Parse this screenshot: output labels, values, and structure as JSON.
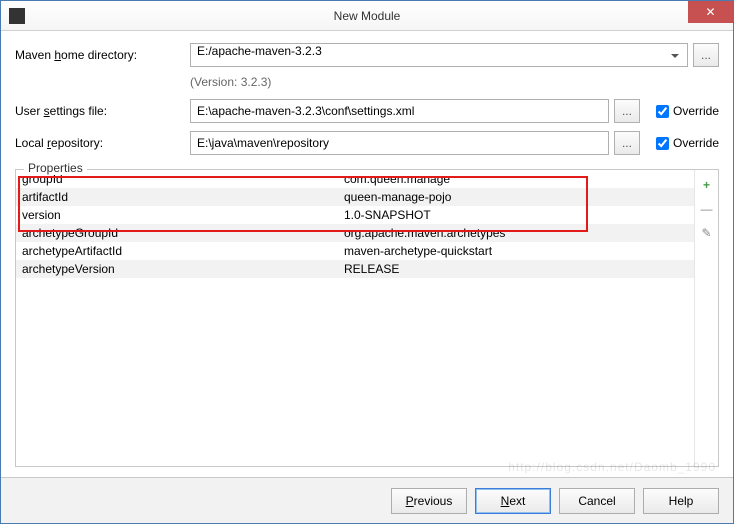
{
  "window": {
    "title": "New Module",
    "icon_letter": "IJ"
  },
  "form": {
    "maven_home_label_pre": "Maven ",
    "maven_home_label_u": "h",
    "maven_home_label_post": "ome directory:",
    "maven_home_value": "E:/apache-maven-3.2.3",
    "version_text": "(Version: 3.2.3)",
    "user_settings_label_pre": "User ",
    "user_settings_label_u": "s",
    "user_settings_label_post": "ettings file:",
    "user_settings_value": "E:\\apache-maven-3.2.3\\conf\\settings.xml",
    "local_repo_label_pre": "Local ",
    "local_repo_label_u": "r",
    "local_repo_label_post": "epository:",
    "local_repo_value": "E:\\java\\maven\\repository",
    "override_label": "Override",
    "browse_label": "..."
  },
  "properties": {
    "legend": "Properties",
    "rows": [
      {
        "key": "groupId",
        "value": "com.queen.manage"
      },
      {
        "key": "artifactId",
        "value": "queen-manage-pojo"
      },
      {
        "key": "version",
        "value": "1.0-SNAPSHOT"
      },
      {
        "key": "archetypeGroupId",
        "value": "org.apache.maven.archetypes"
      },
      {
        "key": "archetypeArtifactId",
        "value": "maven-archetype-quickstart"
      },
      {
        "key": "archetypeVersion",
        "value": "RELEASE"
      }
    ],
    "add_label": "+",
    "remove_label": "—",
    "edit_label": "✎"
  },
  "footer": {
    "previous_u": "P",
    "previous_rest": "revious",
    "next_u": "N",
    "next_rest": "ext",
    "cancel": "Cancel",
    "help": "Help"
  },
  "watermark": "http://blog.csdn.net/Daomb_1990"
}
